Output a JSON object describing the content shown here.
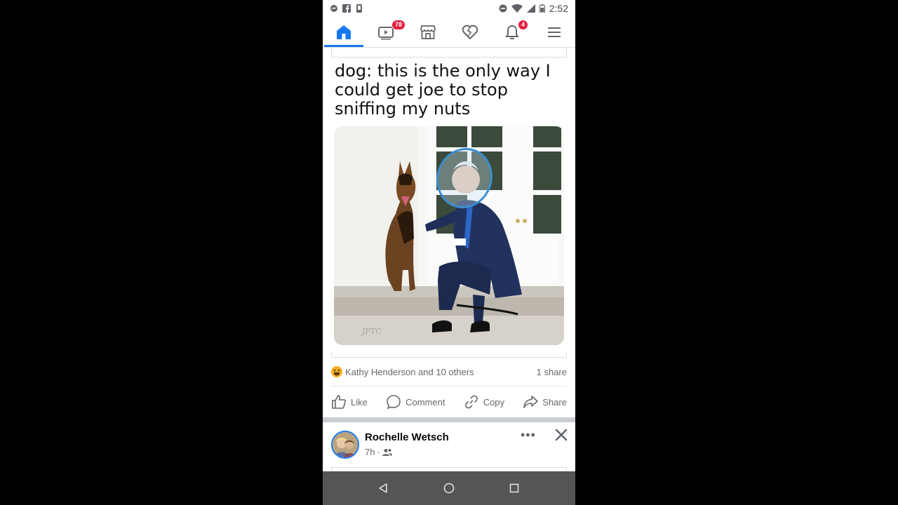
{
  "status_bar": {
    "time": "2:52",
    "left_icons": [
      "messenger-notification-icon",
      "facebook-icon",
      "phone-icon"
    ],
    "right_icons": [
      "do-not-disturb-icon",
      "wifi-icon",
      "signal-icon",
      "battery-icon"
    ]
  },
  "nav": {
    "tabs": [
      {
        "name": "home",
        "icon": "home-icon",
        "active": true
      },
      {
        "name": "watch",
        "icon": "video-icon",
        "badge": "78"
      },
      {
        "name": "marketplace",
        "icon": "store-icon"
      },
      {
        "name": "dating",
        "icon": "heart-icon"
      },
      {
        "name": "notifications",
        "icon": "bell-icon",
        "badge": "4"
      },
      {
        "name": "menu",
        "icon": "menu-icon"
      }
    ]
  },
  "post": {
    "caption": "dog: this is the only way I could get joe to stop sniffing my nuts",
    "image_watermark": "JFTC",
    "reactions_text": "Kathy Henderson and 10 others",
    "shares_text": "1 share",
    "actions": {
      "like": "Like",
      "comment": "Comment",
      "copy": "Copy",
      "share": "Share"
    }
  },
  "next_post": {
    "author": "Rochelle Wetsch",
    "time": "7h",
    "separator": "·",
    "more": "•••"
  },
  "colors": {
    "accent": "#1877f2",
    "badge": "#e41e3f",
    "nav_bar": "#545557"
  }
}
